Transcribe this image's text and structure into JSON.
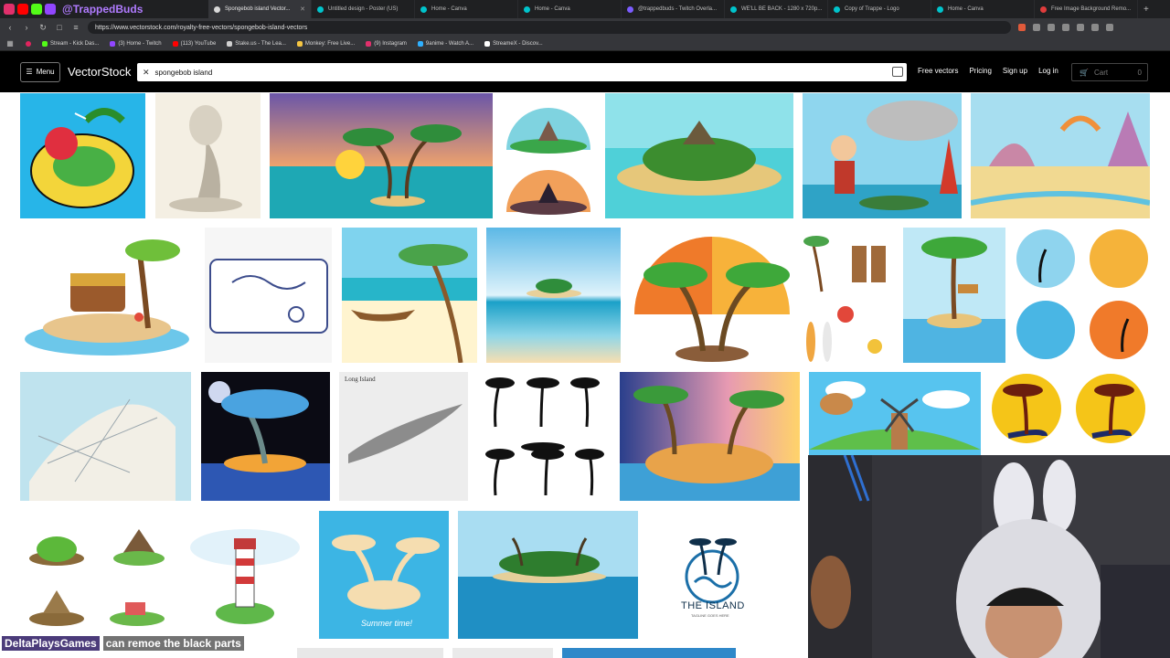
{
  "browser": {
    "streamer_name": "@TrappedBuds",
    "tabs": [
      {
        "title": "Spongebob island Vector...",
        "color": "#d9d9d9",
        "active": true
      },
      {
        "title": "Untitled design - Poster (US)",
        "color": "#00c4cc",
        "active": false
      },
      {
        "title": "Home - Canva",
        "color": "#00c4cc",
        "active": false
      },
      {
        "title": "Home - Canva",
        "color": "#00c4cc",
        "active": false
      },
      {
        "title": "@trappedbuds - Twitch Overla...",
        "color": "#7b5cff",
        "active": false
      },
      {
        "title": "WE'LL BE BACK - 1280 x 720p...",
        "color": "#00c4cc",
        "active": false
      },
      {
        "title": "Copy of Trappe - Logo",
        "color": "#00c4cc",
        "active": false
      },
      {
        "title": "Home - Canva",
        "color": "#00c4cc",
        "active": false
      },
      {
        "title": "Free Image Background Remo...",
        "color": "#e03c3c",
        "active": false
      }
    ],
    "url": "https://www.vectorstock.com/royalty-free-vectors/spongebob-island-vectors",
    "bookmarks": [
      {
        "label": "Stream - Kick Das...",
        "color": "#53fc18"
      },
      {
        "label": "(3) Home - Twitch",
        "color": "#9146ff"
      },
      {
        "label": "(113) YouTube",
        "color": "#ff0000"
      },
      {
        "label": "Stake.us - The Lea...",
        "color": "#d0d0d0"
      },
      {
        "label": "Monkey: Free Live...",
        "color": "#f5c542"
      },
      {
        "label": "(9) Instagram",
        "color": "#e1306c"
      },
      {
        "label": "9anime - Watch A...",
        "color": "#2fb0ff"
      },
      {
        "label": "StreameX - Discov...",
        "color": "#ffffff"
      }
    ]
  },
  "site": {
    "menu_label": "Menu",
    "logo": "VectorStock",
    "search_value": "spongebob island",
    "links": [
      "Free vectors",
      "Pricing",
      "Sign up",
      "Log in"
    ],
    "cart_label": "Cart",
    "cart_count": "0"
  },
  "gallery": {
    "long_island_caption": "Long Island",
    "summer_caption": "Summer time!",
    "island_logo_title": "THE ISLAND",
    "island_logo_tagline": "TAGLINE GOES HERE"
  },
  "stream_overlay": {
    "chat_user": "DeltaPlaysGames",
    "chat_message": "can remoe the black parts"
  }
}
